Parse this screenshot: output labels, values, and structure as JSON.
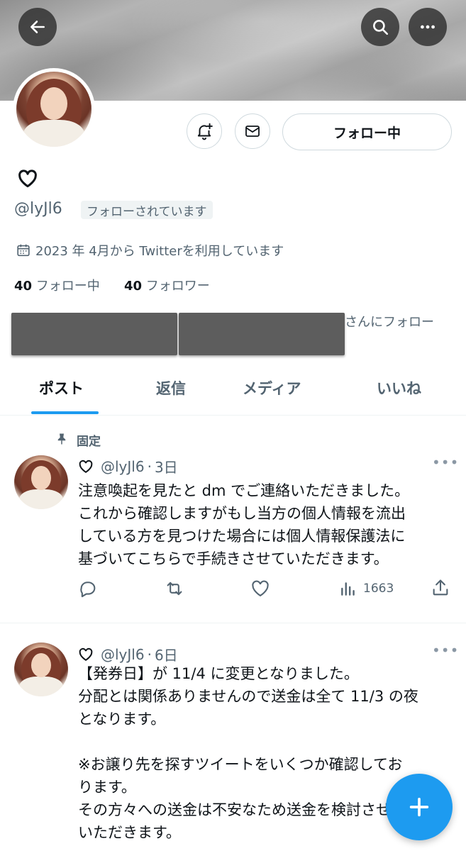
{
  "profile": {
    "display_name_icon": "heart-outline-icon",
    "handle": "@lyJl6",
    "follows_you_badge": "フォローされています",
    "joined": "2023 年 4月から Twitterを利用しています",
    "following_count": "40",
    "following_label": "フォロー中",
    "followers_count": "40",
    "followers_label": "フォロワー",
    "followed_by_suffix": "さんにフォロー"
  },
  "header": {
    "back_icon": "back-arrow-icon",
    "search_icon": "search-icon",
    "more_icon": "more-icon"
  },
  "actions": {
    "notify_icon": "bell-plus-icon",
    "message_icon": "mail-icon",
    "follow_button": "フォロー中"
  },
  "tabs": [
    {
      "label": "ポスト",
      "active": true
    },
    {
      "label": "返信",
      "active": false
    },
    {
      "label": "メディア",
      "active": false
    },
    {
      "label": "いいね",
      "active": false
    }
  ],
  "posts": [
    {
      "pinned_label": "固定",
      "handle": "@lyJl6",
      "time": "3日",
      "text": "注意喚起を見たと dm でご連絡いただきました。\nこれから確認しますがもし当方の個人情報を流出\nしている方を見つけた場合には個人情報保護法に\n基づいてこちらで手続きさせていただきます。",
      "views": "1663"
    },
    {
      "handle": "@lyJl6",
      "time": "6日",
      "text": "【発券日】が 11/4 に変更となりました。\n分配とは関係ありませんので送金は全て 11/3 の夜\nとなります。\n\n※お譲り先を探すツイートをいくつか確認してお\nります。\nその方々への送金は不安なため送金を検討させて\nいただきます。"
    }
  ],
  "colors": {
    "accent": "#1d9bf0",
    "text": "#0f1419",
    "secondary": "#536471",
    "border": "#cfd9de"
  }
}
